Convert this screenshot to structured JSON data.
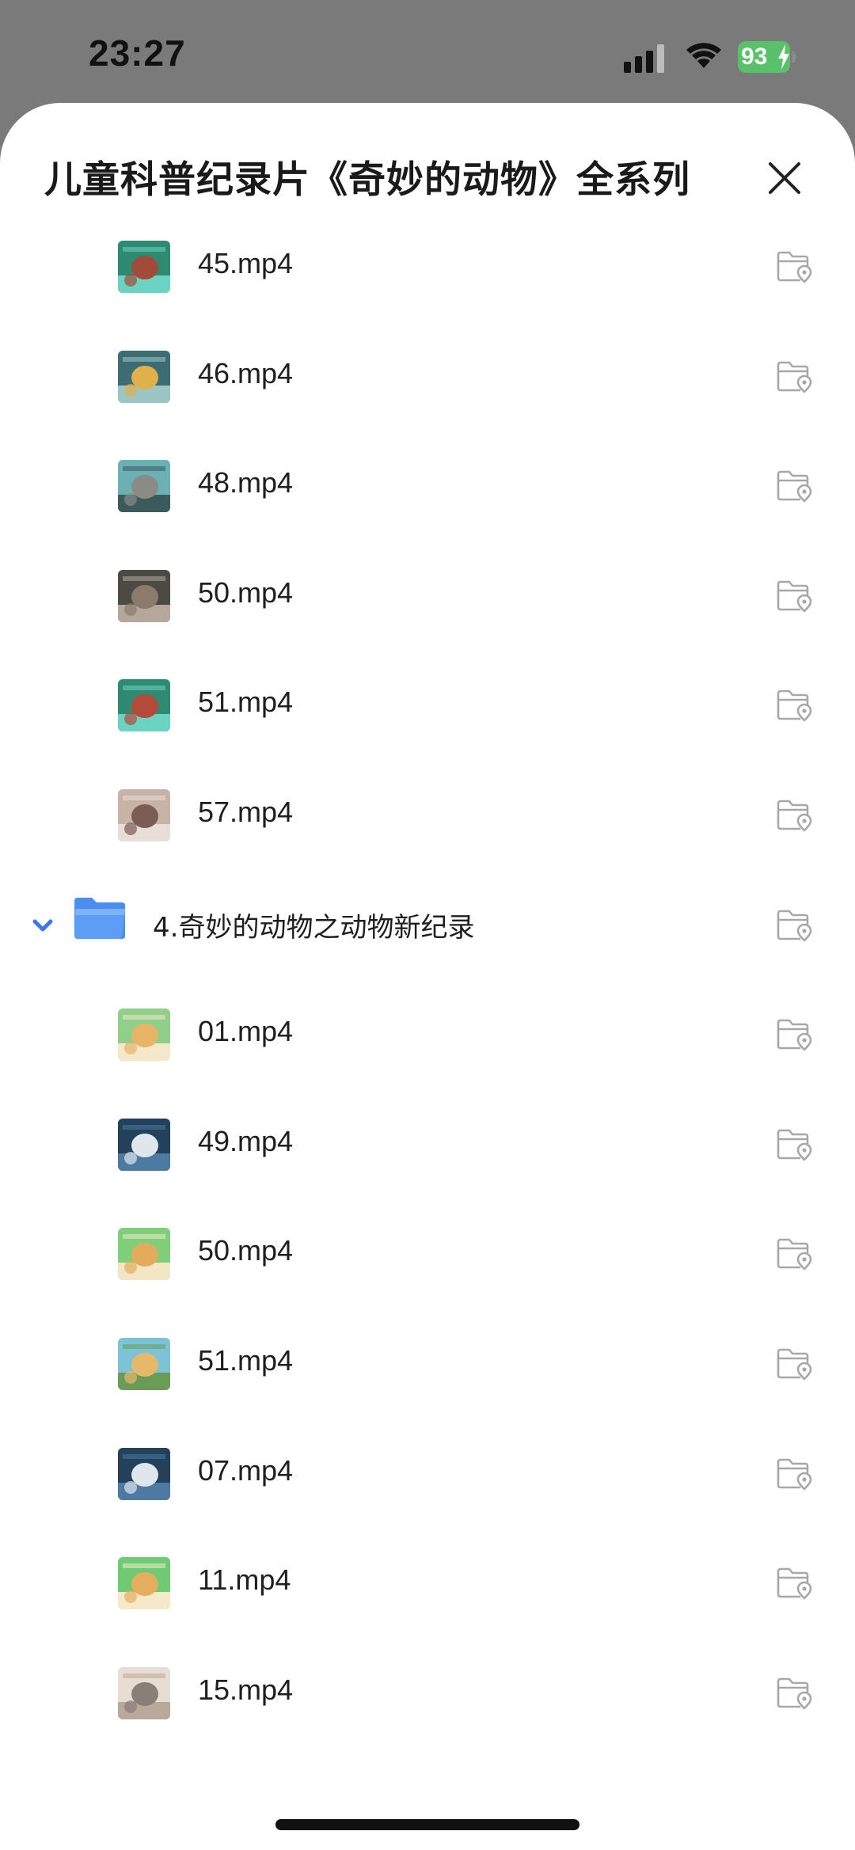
{
  "status_bar": {
    "time": "23:27",
    "battery": "93",
    "battery_color": "#59c169"
  },
  "sheet": {
    "title": "儿童科普纪录片《奇妙的动物》全系列",
    "close_icon": "close-icon"
  },
  "items": [
    {
      "name": "45.mp4",
      "kind": "video",
      "thumb_colors": [
        "#2f8a72",
        "#a34b3a",
        "#6bd3c2"
      ]
    },
    {
      "name": "46.mp4",
      "kind": "video",
      "thumb_colors": [
        "#3c6d74",
        "#e0b04b",
        "#9cc6c4"
      ]
    },
    {
      "name": "48.mp4",
      "kind": "video",
      "thumb_colors": [
        "#6bb0b4",
        "#8b8a85",
        "#3a5a5c"
      ]
    },
    {
      "name": "50.mp4",
      "kind": "video",
      "thumb_colors": [
        "#4b4a45",
        "#8c7a6a",
        "#b5a89a"
      ]
    },
    {
      "name": "51.mp4",
      "kind": "video",
      "thumb_colors": [
        "#2f8a72",
        "#b5493a",
        "#6bd3c2"
      ]
    },
    {
      "name": "57.mp4",
      "kind": "video",
      "thumb_colors": [
        "#c9b3a6",
        "#7a5d55",
        "#e8ded8"
      ]
    },
    {
      "name": "4.奇妙的动物之动物新纪录",
      "kind": "folder",
      "expanded": true
    },
    {
      "name": "01.mp4",
      "kind": "video",
      "thumb_colors": [
        "#8fcf8a",
        "#e7b468",
        "#f4e8c8"
      ]
    },
    {
      "name": "49.mp4",
      "kind": "video",
      "thumb_colors": [
        "#23415a",
        "#dfe6ec",
        "#4c7aa0"
      ]
    },
    {
      "name": "50.mp4",
      "kind": "video",
      "thumb_colors": [
        "#7fcf7a",
        "#e3ac5c",
        "#f2e6c4"
      ]
    },
    {
      "name": "51.mp4",
      "kind": "video",
      "thumb_colors": [
        "#7cc3d8",
        "#e6b86a",
        "#6a9c58"
      ]
    },
    {
      "name": "07.mp4",
      "kind": "video",
      "thumb_colors": [
        "#23415a",
        "#dfe6ec",
        "#4c7aa0"
      ]
    },
    {
      "name": "11.mp4",
      "kind": "video",
      "thumb_colors": [
        "#6ecb74",
        "#e5ae5e",
        "#f5e9c9"
      ]
    },
    {
      "name": "15.mp4",
      "kind": "video",
      "thumb_colors": [
        "#e8ddd2",
        "#8a7e78",
        "#b9a99b"
      ]
    }
  ],
  "icons": {
    "save_to_folder": "folder-location-icon",
    "expand": "chevron-down-icon",
    "folder": "folder-icon"
  },
  "colors": {
    "folder_blue": "#5e9df5",
    "chevron_blue": "#3b78f0",
    "action_gray": "#a8a8a8"
  }
}
